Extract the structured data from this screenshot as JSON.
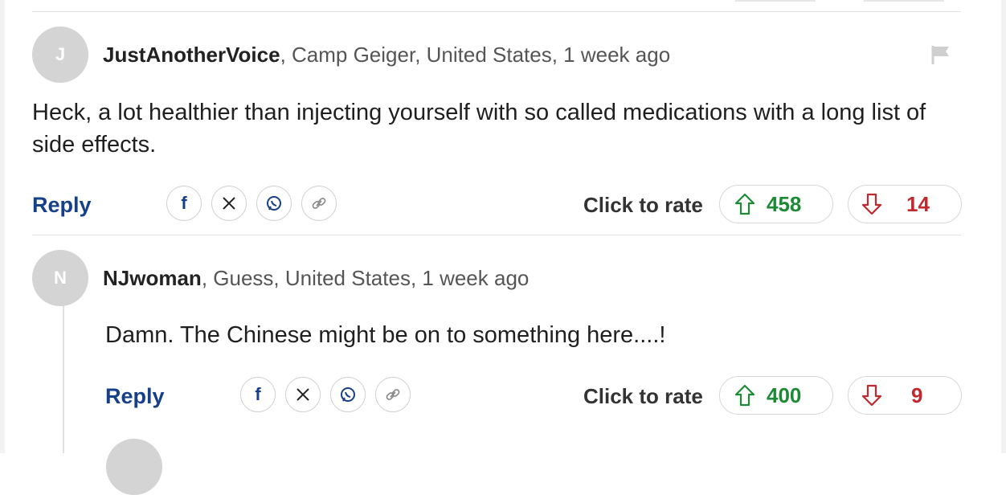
{
  "rate_label": "Click to rate",
  "reply_label": "Reply",
  "share_icons": [
    "facebook-icon",
    "x-icon",
    "whatsapp-icon",
    "link-icon"
  ],
  "colors": {
    "reply": "#17408b",
    "upvote": "#1d8a36",
    "downvote": "#c1292e",
    "avatar": "#d4d4d4"
  },
  "comments": [
    {
      "avatar_letter": "J",
      "username": "JustAnotherVoice",
      "location_time": ", Camp Geiger, United States, 1 week ago",
      "text": "Heck, a lot healthier than injecting yourself with so called medications with a long list of side effects.",
      "upvotes": "458",
      "downvotes": "14"
    },
    {
      "avatar_letter": "N",
      "username": "NJwoman",
      "location_time": ", Guess, United States, 1 week ago",
      "text": "Damn. The Chinese might be on to something here....!",
      "upvotes": "400",
      "downvotes": "9"
    }
  ]
}
